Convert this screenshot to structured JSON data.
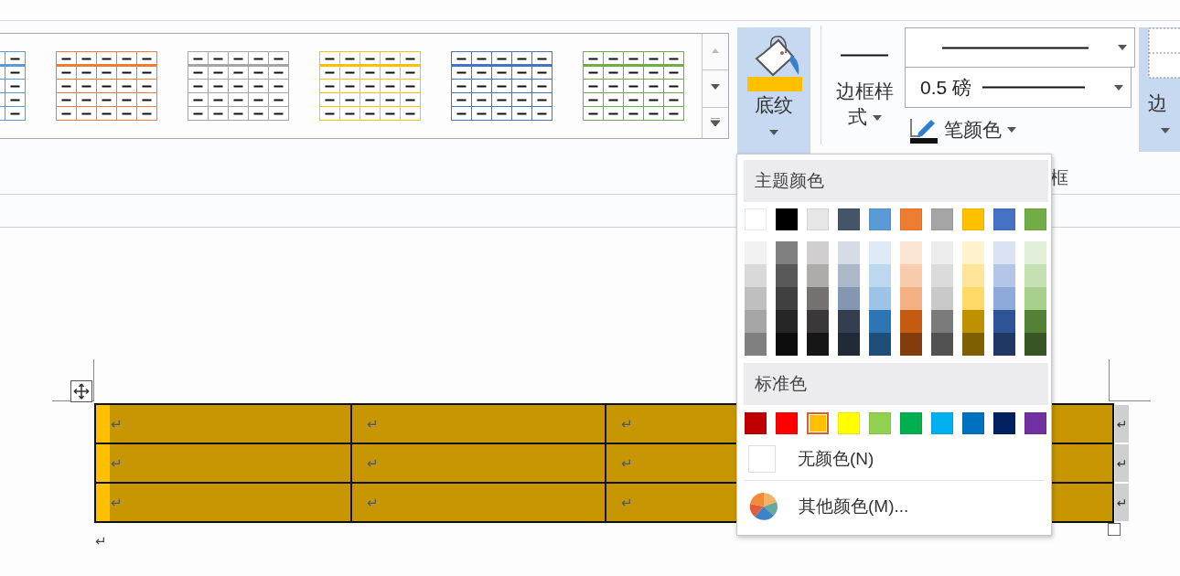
{
  "gallery": {
    "styles": [
      {
        "color": "#5b9bd5"
      },
      {
        "color": "#ed7d31"
      },
      {
        "color": "#a5a5a5"
      },
      {
        "color": "#ffc000"
      },
      {
        "color": "#4472c4"
      },
      {
        "color": "#70ad47"
      }
    ]
  },
  "shading_button": {
    "label": "底纹",
    "expanded": true
  },
  "border_style_button": {
    "label": "边框样式"
  },
  "line_weight_field": {
    "value": "0.5 磅"
  },
  "pen_color_button": {
    "label": "笔颜色"
  },
  "borders_button": {
    "label": "边",
    "selected": true
  },
  "group_label": "框",
  "color_menu": {
    "theme_title": "主题颜色",
    "theme_colors": [
      {
        "color": "#ffffff",
        "shades": [
          {
            "color": "#f2f2f2"
          },
          {
            "color": "#d9d9d9"
          },
          {
            "color": "#bfbfbf"
          },
          {
            "color": "#a6a6a6"
          },
          {
            "color": "#808080"
          }
        ]
      },
      {
        "color": "#000000",
        "shades": [
          {
            "color": "#808080"
          },
          {
            "color": "#595959"
          },
          {
            "color": "#404040"
          },
          {
            "color": "#262626"
          },
          {
            "color": "#0d0d0d"
          }
        ]
      },
      {
        "color": "#e7e6e6",
        "shades": [
          {
            "color": "#d0cece"
          },
          {
            "color": "#aeabab"
          },
          {
            "color": "#757171"
          },
          {
            "color": "#3a3838"
          },
          {
            "color": "#171616"
          }
        ]
      },
      {
        "color": "#44546a",
        "shades": [
          {
            "color": "#d6dce4"
          },
          {
            "color": "#adb9ca"
          },
          {
            "color": "#8497b0"
          },
          {
            "color": "#333f4f"
          },
          {
            "color": "#222a35"
          }
        ]
      },
      {
        "color": "#5b9bd5",
        "shades": [
          {
            "color": "#deebf6"
          },
          {
            "color": "#bdd7ee"
          },
          {
            "color": "#9dc3e6"
          },
          {
            "color": "#2e75b5"
          },
          {
            "color": "#1f4e79"
          }
        ]
      },
      {
        "color": "#ed7d31",
        "shades": [
          {
            "color": "#fbe5d5"
          },
          {
            "color": "#f7cbac"
          },
          {
            "color": "#f4b183"
          },
          {
            "color": "#c55a11"
          },
          {
            "color": "#833c0b"
          }
        ]
      },
      {
        "color": "#a5a5a5",
        "shades": [
          {
            "color": "#ededed"
          },
          {
            "color": "#dbdbdb"
          },
          {
            "color": "#c9c9c9"
          },
          {
            "color": "#7b7b7b"
          },
          {
            "color": "#525252"
          }
        ]
      },
      {
        "color": "#ffc000",
        "shades": [
          {
            "color": "#fff2cc"
          },
          {
            "color": "#ffe599"
          },
          {
            "color": "#ffd966"
          },
          {
            "color": "#bf9000"
          },
          {
            "color": "#7f6000"
          }
        ]
      },
      {
        "color": "#4472c4",
        "shades": [
          {
            "color": "#dae3f3"
          },
          {
            "color": "#b4c6e7"
          },
          {
            "color": "#8eaadb"
          },
          {
            "color": "#2f5496"
          },
          {
            "color": "#1f3864"
          }
        ]
      },
      {
        "color": "#70ad47",
        "shades": [
          {
            "color": "#e2efd9"
          },
          {
            "color": "#c5e0b3"
          },
          {
            "color": "#a8d08d"
          },
          {
            "color": "#538135"
          },
          {
            "color": "#375623"
          }
        ]
      }
    ],
    "standard_title": "标准色",
    "standard_colors": [
      {
        "color": "#c00000",
        "selected": false
      },
      {
        "color": "#ff0000",
        "selected": false
      },
      {
        "color": "#ffc000",
        "selected": true
      },
      {
        "color": "#ffff00",
        "selected": false
      },
      {
        "color": "#92d050",
        "selected": false
      },
      {
        "color": "#00b050",
        "selected": false
      },
      {
        "color": "#00b0f0",
        "selected": false
      },
      {
        "color": "#0070c0",
        "selected": false
      },
      {
        "color": "#002060",
        "selected": false
      },
      {
        "color": "#7030a0",
        "selected": false
      }
    ],
    "items": [
      {
        "kind": "no_color",
        "label": "无颜色(N)"
      },
      {
        "kind": "more",
        "label": "其他颜色(M)..."
      }
    ]
  },
  "table": {
    "rows": [
      {
        "cells": [
          "↵",
          "↵",
          "↵"
        ],
        "end_mark": "↵"
      },
      {
        "cells": [
          "↵",
          "↵",
          "↵"
        ],
        "end_mark": "↵"
      },
      {
        "cells": [
          "↵",
          "↵",
          "↵"
        ],
        "end_mark": "↵"
      }
    ]
  },
  "paragraph_mark": "↵"
}
